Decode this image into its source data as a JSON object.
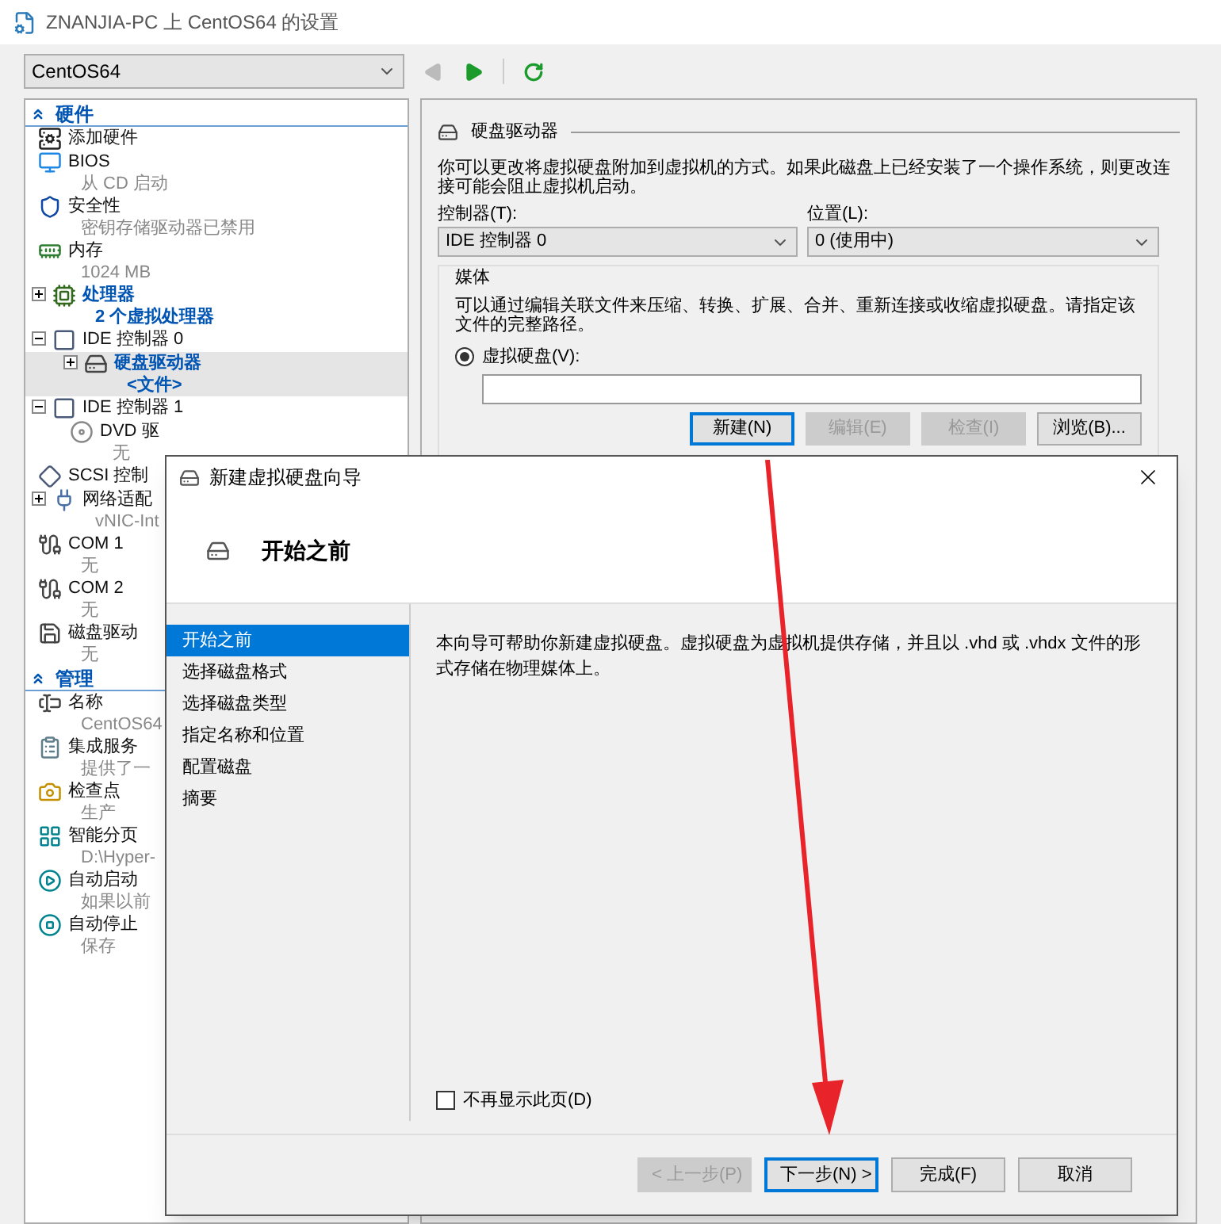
{
  "window": {
    "title": "ZNANJIA-PC 上 CentOS64 的设置"
  },
  "toolbar": {
    "vm_select": "CentOS64",
    "back_disabled": true,
    "forward_disabled": false
  },
  "tree": [
    {
      "header": "硬件",
      "items": [
        {
          "label": "添加硬件",
          "changed": false,
          "selected": false
        },
        {
          "label": "BIOS",
          "detail": "从 CD 启动",
          "changed": false,
          "selected": false
        },
        {
          "label": "安全性",
          "detail": "密钥存储驱动器已禁用",
          "changed": false,
          "selected": false
        },
        {
          "label": "内存",
          "detail": "1024 MB",
          "changed": false,
          "selected": false
        },
        {
          "label": "处理器",
          "detail": "2 个虚拟处理器",
          "changed": true,
          "selected": false,
          "expanded": false
        },
        {
          "label": "IDE 控制器 0",
          "changed": false,
          "selected": false,
          "expanded": true,
          "children": [
            {
              "label": "硬盘驱动器",
              "detail": "<文件>",
              "changed": true,
              "selected": true,
              "expanded": false
            }
          ]
        },
        {
          "label": "IDE 控制器 1",
          "changed": false,
          "selected": false,
          "expanded": true,
          "children": [
            {
              "label": "DVD 驱",
              "detail": "无",
              "changed": false,
              "selected": false
            }
          ]
        },
        {
          "label": "SCSI 控制",
          "changed": false,
          "selected": false
        },
        {
          "label": "网络适配",
          "detail": "vNIC-Int",
          "changed": false,
          "selected": false,
          "expanded": false
        },
        {
          "label": "COM 1",
          "detail": "无",
          "changed": false,
          "selected": false
        },
        {
          "label": "COM 2",
          "detail": "无",
          "changed": false,
          "selected": false
        },
        {
          "label": "磁盘驱动",
          "detail": "无",
          "changed": false,
          "selected": false
        }
      ]
    },
    {
      "header": "管理",
      "items": [
        {
          "label": "名称",
          "detail": "CentOS64",
          "changed": false,
          "selected": false
        },
        {
          "label": "集成服务",
          "detail": "提供了一",
          "changed": false,
          "selected": false
        },
        {
          "label": "检查点",
          "detail": "生产",
          "changed": false,
          "selected": false
        },
        {
          "label": "智能分页",
          "detail": "D:\\Hyper-",
          "changed": false,
          "selected": false
        },
        {
          "label": "自动启动",
          "detail": "如果以前",
          "changed": false,
          "selected": false
        },
        {
          "label": "自动停止",
          "detail": "保存",
          "changed": false,
          "selected": false
        }
      ]
    }
  ],
  "panel": {
    "title": "硬盘驱动器",
    "description": "你可以更改将虚拟硬盘附加到虚拟机的方式。如果此磁盘上已经安装了一个操作系统，则更改连接可能会阻止虚拟机启动。",
    "controller_label": "控制器(T):",
    "controller_value": "IDE 控制器 0",
    "location_label": "位置(L):",
    "location_value": "0 (使用中)",
    "media": {
      "title": "媒体",
      "description": "可以通过编辑关联文件来压缩、转换、扩展、合并、重新连接或收缩虚拟硬盘。请指定该文件的完整路径。",
      "radio": {
        "label": "虚拟硬盘(V):",
        "selected": true
      },
      "buttons": [
        {
          "label": "新建(N)",
          "disabled": false,
          "focused": true
        },
        {
          "label": "编辑(E)",
          "disabled": true,
          "focused": false
        },
        {
          "label": "检查(I)",
          "disabled": true,
          "focused": false
        },
        {
          "label": "浏览(B)...",
          "disabled": false,
          "focused": false
        }
      ]
    }
  },
  "dialog": {
    "title": "新建虚拟硬盘向导",
    "heading": "开始之前",
    "steps": [
      {
        "label": "开始之前",
        "selected": true
      },
      {
        "label": "选择磁盘格式",
        "selected": false
      },
      {
        "label": "选择磁盘类型",
        "selected": false
      },
      {
        "label": "指定名称和位置",
        "selected": false
      },
      {
        "label": "配置磁盘",
        "selected": false
      },
      {
        "label": "摘要",
        "selected": false
      }
    ],
    "body": "本向导可帮助你新建虚拟硬盘。虚拟硬盘为虚拟机提供存储，并且以 .vhd 或 .vhdx 文件的形式存储在物理媒体上。",
    "dont_show": {
      "label": "不再显示此页(D)",
      "checked": false
    },
    "buttons": [
      {
        "label": "< 上一步(P)",
        "disabled": true,
        "focused": false
      },
      {
        "label": "下一步(N) >",
        "disabled": false,
        "focused": true
      },
      {
        "label": "完成(F)",
        "disabled": false,
        "focused": false
      },
      {
        "label": "取消",
        "disabled": false,
        "focused": false
      }
    ]
  }
}
